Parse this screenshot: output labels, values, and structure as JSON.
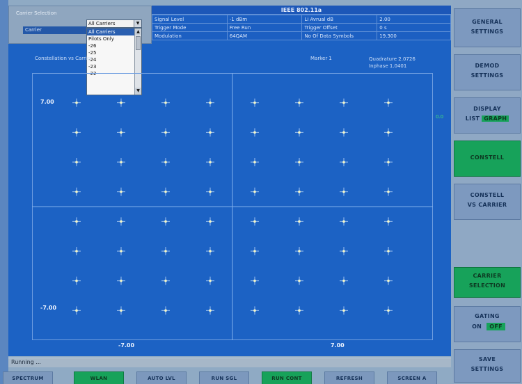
{
  "header": {
    "title": "IEEE 802.11a",
    "rows": [
      [
        "Signal Level",
        "-1 dBm",
        "Li Avrual dB",
        "2.00"
      ],
      [
        "Trigger Mode",
        "Free Run",
        "Trigger Offset",
        "0 s"
      ],
      [
        "Modulation",
        "64QAM",
        "No Of Data Symbols",
        "19.300"
      ]
    ]
  },
  "carrier_panel": {
    "title": "Carrier Selection",
    "label": "Carrier",
    "selected": "All Carriers",
    "options": [
      "All Carriers",
      "Pilots Only",
      "-26",
      "-25",
      "-24",
      "-23",
      "-22"
    ]
  },
  "plot": {
    "title": "Constellation vs Carrier",
    "marker": "Marker 1",
    "coord_lines": [
      "Quadrature   2.0726",
      "Inphase      1.0401"
    ],
    "side_marker": "0.0",
    "y_top": "7.00",
    "y_bottom": "-7.00",
    "x_left": "-7.00",
    "x_right": "7.00"
  },
  "chart_data": {
    "type": "scatter",
    "title": "",
    "xlabel": "",
    "ylabel": "",
    "xlim": [
      -9,
      9
    ],
    "ylim": [
      -9,
      9
    ],
    "x_ticks": [
      "-7.00",
      "7.00"
    ],
    "y_ticks": [
      "-7.00",
      "7.00"
    ],
    "series": [
      {
        "points": [
          [
            -7,
            7
          ],
          [
            -5,
            7
          ],
          [
            -3,
            7
          ],
          [
            -1,
            7
          ],
          [
            1,
            7
          ],
          [
            3,
            7
          ],
          [
            5,
            7
          ],
          [
            7,
            7
          ],
          [
            -7,
            5
          ],
          [
            -5,
            5
          ],
          [
            -3,
            5
          ],
          [
            -1,
            5
          ],
          [
            1,
            5
          ],
          [
            3,
            5
          ],
          [
            5,
            5
          ],
          [
            7,
            5
          ],
          [
            -7,
            3
          ],
          [
            -5,
            3
          ],
          [
            -3,
            3
          ],
          [
            -1,
            3
          ],
          [
            1,
            3
          ],
          [
            3,
            3
          ],
          [
            5,
            3
          ],
          [
            7,
            3
          ],
          [
            -7,
            1
          ],
          [
            -5,
            1
          ],
          [
            -3,
            1
          ],
          [
            -1,
            1
          ],
          [
            1,
            1
          ],
          [
            3,
            1
          ],
          [
            5,
            1
          ],
          [
            7,
            1
          ],
          [
            -7,
            -1
          ],
          [
            -5,
            -1
          ],
          [
            -3,
            -1
          ],
          [
            -1,
            -1
          ],
          [
            1,
            -1
          ],
          [
            3,
            -1
          ],
          [
            5,
            -1
          ],
          [
            7,
            -1
          ],
          [
            -7,
            -3
          ],
          [
            -5,
            -3
          ],
          [
            -3,
            -3
          ],
          [
            -1,
            -3
          ],
          [
            1,
            -3
          ],
          [
            3,
            -3
          ],
          [
            5,
            -3
          ],
          [
            7,
            -3
          ],
          [
            -7,
            -5
          ],
          [
            -5,
            -5
          ],
          [
            -3,
            -5
          ],
          [
            -1,
            -5
          ],
          [
            1,
            -5
          ],
          [
            3,
            -5
          ],
          [
            5,
            -5
          ],
          [
            7,
            -5
          ],
          [
            -7,
            -7
          ],
          [
            -5,
            -7
          ],
          [
            -3,
            -7
          ],
          [
            -1,
            -7
          ],
          [
            1,
            -7
          ],
          [
            3,
            -7
          ],
          [
            5,
            -7
          ],
          [
            7,
            -7
          ]
        ]
      }
    ],
    "grid": false,
    "colors": {
      "points": "#f4f7c8",
      "background": "#1c62c4",
      "axes": "#7fb0ec"
    }
  },
  "status": "Running ...",
  "bottom_buttons": [
    {
      "label": "SPECTRUM",
      "active": false
    },
    {
      "label": "WLAN",
      "active": true
    },
    {
      "label": "AUTO LVL",
      "active": false
    },
    {
      "label": "RUN SGL",
      "active": false
    },
    {
      "label": "RUN CONT",
      "active": true
    },
    {
      "label": "REFRESH",
      "active": false
    },
    {
      "label": "SCREEN A",
      "active": false
    }
  ],
  "side_buttons": {
    "general": [
      "GENERAL",
      "SETTINGS"
    ],
    "demod": [
      "DEMOD",
      "SETTINGS"
    ],
    "display": {
      "line1": "DISPLAY",
      "list": "LIST",
      "graph": "GRAPH"
    },
    "constell": [
      "CONSTELL"
    ],
    "constell_carrier": [
      "CONSTELL",
      "VS CARRIER"
    ],
    "carrier_selection": [
      "CARRIER",
      "SELECTION"
    ],
    "gating": {
      "line1": "GATING",
      "on": "ON",
      "off": "OFF"
    },
    "save": [
      "SAVE",
      "SETTINGS"
    ]
  }
}
